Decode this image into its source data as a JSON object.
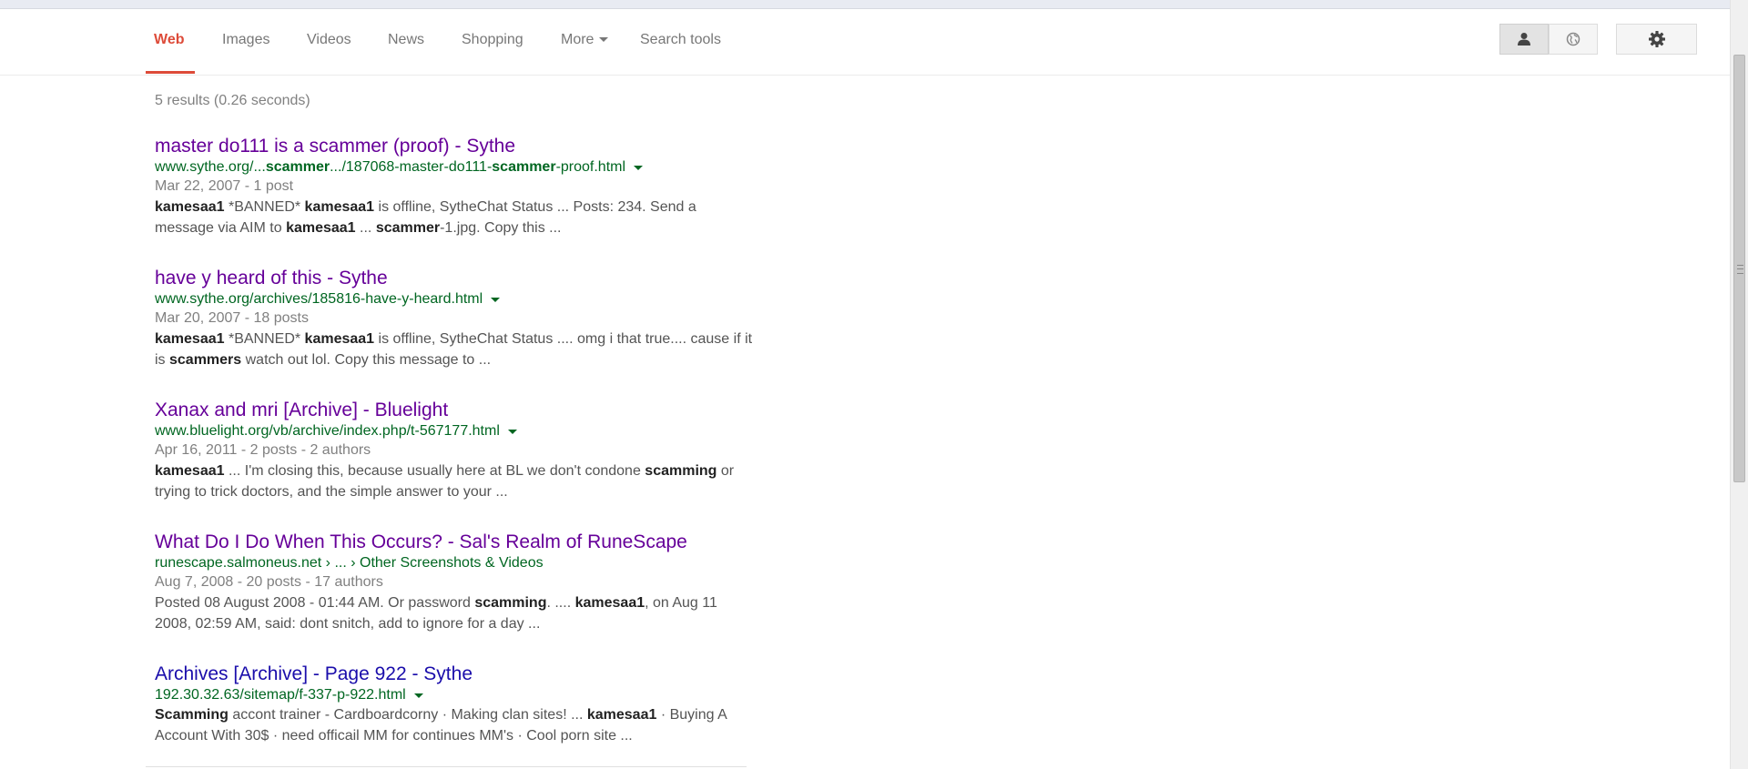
{
  "nav": {
    "tabs": [
      {
        "label": "Web",
        "active": true
      },
      {
        "label": "Images"
      },
      {
        "label": "Videos"
      },
      {
        "label": "News"
      },
      {
        "label": "Shopping"
      },
      {
        "label": "More"
      },
      {
        "label": "Search tools"
      }
    ],
    "icons": [
      "person-icon",
      "globe-icon",
      "gear-icon"
    ]
  },
  "stats": "5 results (0.26 seconds)",
  "results": [
    {
      "title": "master do111 is a scammer (proof) - Sythe",
      "url_html": "www.sythe.org/...<b>scammer</b>.../187068-master-do111-<b>scammer</b>-proof.html",
      "date": "Mar 22, 2007 - 1 post",
      "snippet_html": "<b>kamesaa1</b> *BANNED* <b>kamesaa1</b> is offline, SytheChat Status ... Posts: 234. Send a message via AIM to <b>kamesaa1</b> ... <b>scammer</b>-1.jpg. Copy this ...",
      "visited": true
    },
    {
      "title": "have y heard of this - Sythe",
      "url_html": "www.sythe.org/archives/185816-have-y-heard.html",
      "date": "Mar 20, 2007 - 18 posts",
      "snippet_html": "<b>kamesaa1</b> *BANNED* <b>kamesaa1</b> is offline, SytheChat Status .... omg i that true.... cause if it is <b>scammers</b> watch out lol. Copy this message to ...",
      "visited": true
    },
    {
      "title": "Xanax and mri [Archive] - Bluelight",
      "url_html": "www.bluelight.org/vb/archive/index.php/t-567177.html",
      "date": "Apr 16, 2011 - 2 posts - 2 authors",
      "snippet_html": "<b>kamesaa1</b> ... I'm closing this, because usually here at BL we don't condone <b>scamming</b> or trying to trick doctors, and the simple answer to your ...",
      "visited": true
    },
    {
      "title": "What Do I Do When This Occurs? - Sal's Realm of RuneScape",
      "url_html": "runescape.salmoneus.net › ... › Other Screenshots &amp; Videos",
      "date": "Aug 7, 2008 - 20 posts - 17 authors",
      "snippet_html": "Posted 08 August 2008 - 01:44 AM. Or password <b>scamming</b>. .... <b>kamesaa1</b>, on Aug 11 2008, 02:59 AM, said: dont snitch, add to ignore for a day ...",
      "visited": true
    },
    {
      "title": "Archives [Archive] - Page 922 - Sythe",
      "url_html": "192.30.32.63/sitemap/f-337-p-922.html",
      "date": "",
      "snippet_html": "<b>Scamming</b> accont trainer - Cardboardcorny · Making clan sites! ... <b>kamesaa1</b> · Buying A Account With 30$ · need officail MM for continues MM's · Cool porn site ...",
      "visited": false
    }
  ],
  "colors": {
    "accent": "#dd4b39",
    "link_visited": "#660099",
    "link": "#1a0dab",
    "url": "#006621",
    "meta": "#808080"
  }
}
